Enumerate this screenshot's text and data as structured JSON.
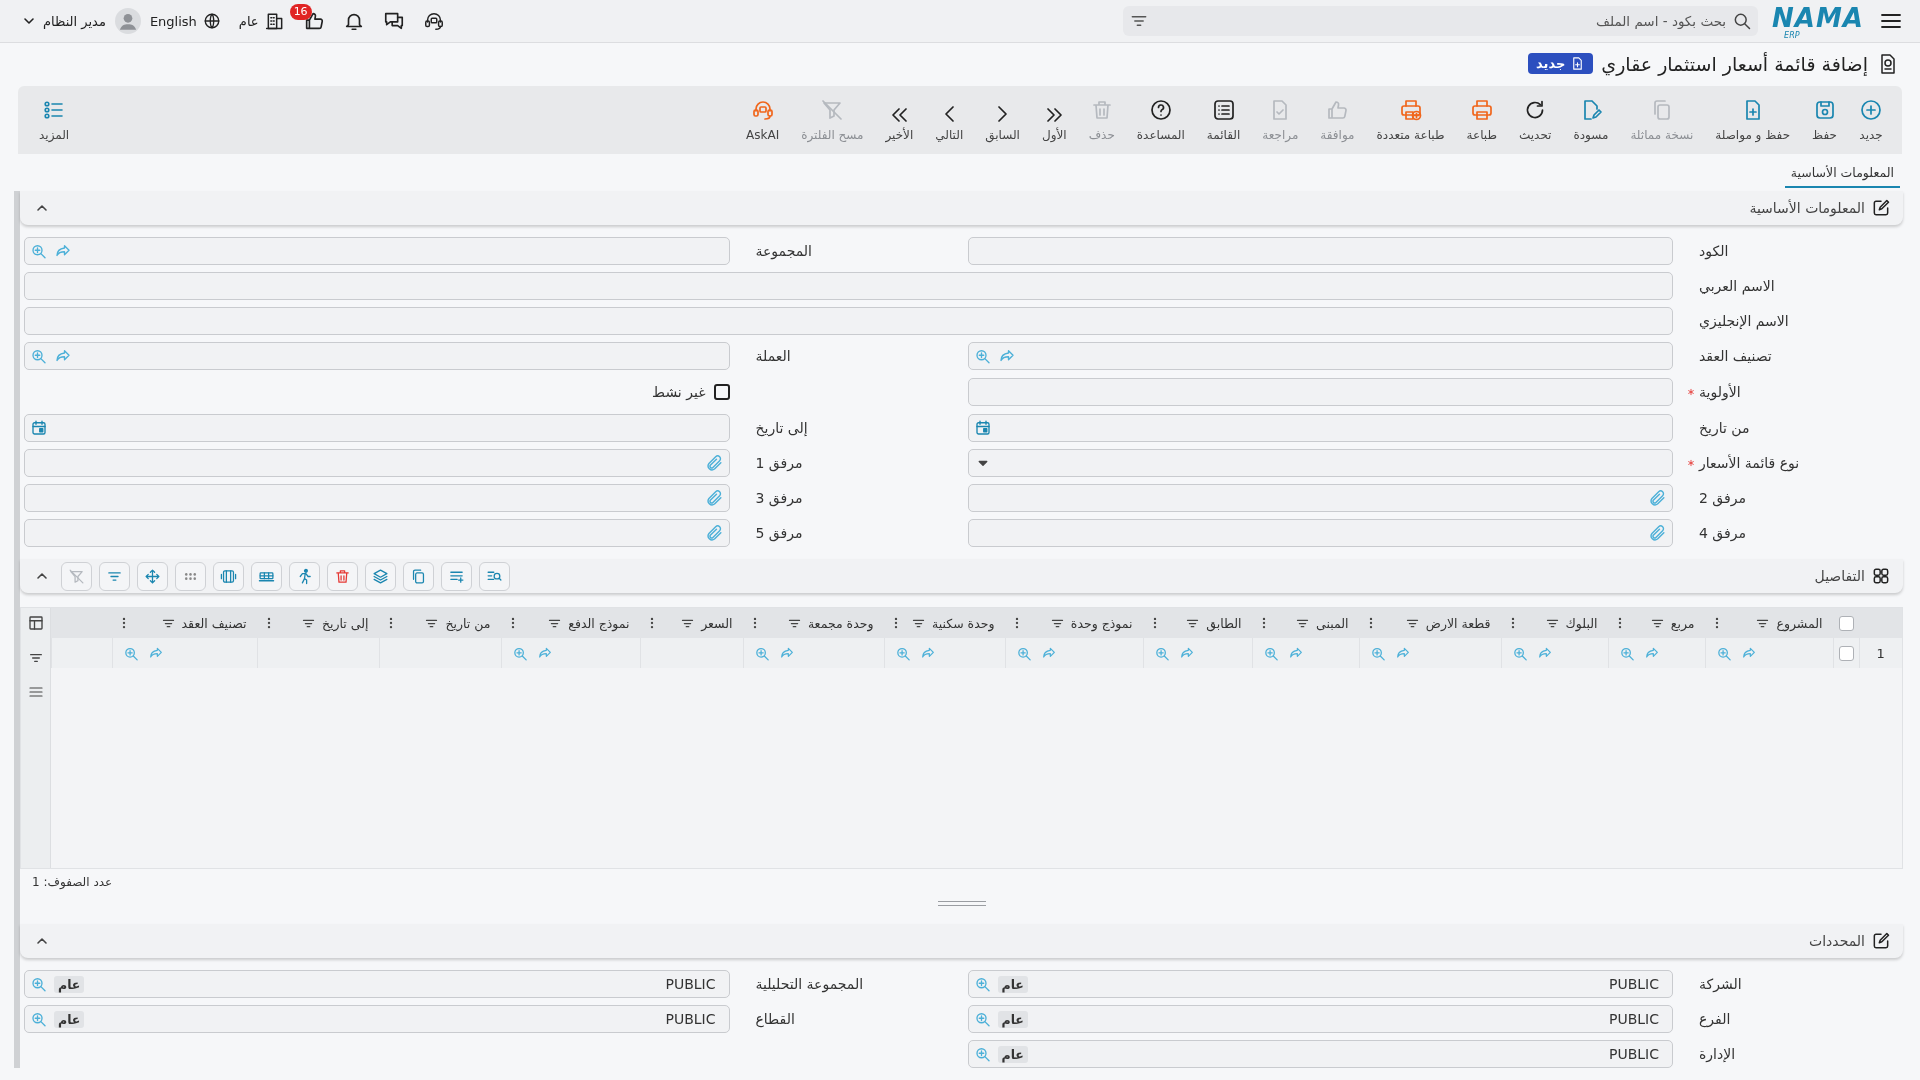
{
  "topbar": {
    "logo": "NAMA",
    "logo_sub": "ERP",
    "search": {
      "placeholder": "بحث بكود - اسم الملف"
    },
    "notification_count": "16",
    "branch": "عام",
    "language": "English",
    "user": "مدير النظام"
  },
  "page": {
    "title": "إضافة قائمة أسعار استثمار عقاري",
    "status": "جديد"
  },
  "toolbar": {
    "items": [
      {
        "kind": "add",
        "label": "جديد",
        "disabled": false
      },
      {
        "kind": "save",
        "label": "حفظ",
        "disabled": false
      },
      {
        "kind": "savenext",
        "label": "حفظ و مواصلة",
        "disabled": false
      },
      {
        "kind": "clone",
        "label": "نسخة مماثلة",
        "disabled": true
      },
      {
        "kind": "draft",
        "label": "مسودة",
        "disabled": false
      },
      {
        "kind": "refresh",
        "label": "تحديث",
        "disabled": false
      },
      {
        "kind": "print",
        "label": "طباعة",
        "disabled": false
      },
      {
        "kind": "multiprint",
        "label": "طباعة متعددة",
        "disabled": false
      },
      {
        "kind": "approve",
        "label": "موافقة",
        "disabled": true
      },
      {
        "kind": "review",
        "label": "مراجعة",
        "disabled": true
      },
      {
        "kind": "list",
        "label": "القائمة",
        "disabled": false
      },
      {
        "kind": "help",
        "label": "المساعدة",
        "disabled": false
      },
      {
        "kind": "delete",
        "label": "حذف",
        "disabled": true
      },
      {
        "kind": "first",
        "label": "الأول",
        "disabled": false
      },
      {
        "kind": "previous",
        "label": "السابق",
        "disabled": false
      },
      {
        "kind": "next",
        "label": "التالي",
        "disabled": false
      },
      {
        "kind": "last",
        "label": "الأخير",
        "disabled": false
      },
      {
        "kind": "clearfilter",
        "label": "مسح الفلترة",
        "disabled": true
      },
      {
        "kind": "askai",
        "label": "AskAI",
        "disabled": false
      }
    ],
    "more": {
      "label": "المزيد"
    }
  },
  "tabs": [
    {
      "label": "المعلومات الأساسية",
      "selected": true
    }
  ],
  "basic_info": {
    "title": "المعلومات الأساسية",
    "expanded": true,
    "fields": [
      {
        "kind": "text",
        "label": "الكود",
        "required": false
      },
      {
        "kind": "lookup",
        "label": "المجموعة",
        "required": false
      },
      {
        "kind": "fulltext",
        "label": "الاسم العربي",
        "required": false
      },
      {
        "kind": "fulltext",
        "label": "الاسم الإنجليزي",
        "required": false
      },
      {
        "kind": "lookup",
        "label": "تصنيف العقد",
        "required": false
      },
      {
        "kind": "lookup",
        "label": "العملة",
        "required": false
      },
      {
        "kind": "text",
        "label": "الأولوية",
        "required": true
      },
      {
        "kind": "checkbox",
        "label": "غير نشط",
        "checked": false
      },
      {
        "kind": "date",
        "label": "من تاريخ",
        "required": false
      },
      {
        "kind": "date",
        "label": "إلى تاريخ",
        "required": false
      },
      {
        "kind": "select",
        "label": "نوع قائمة الأسعار",
        "required": true
      },
      {
        "kind": "attachment",
        "label": "مرفق 1",
        "required": false
      },
      {
        "kind": "attachment",
        "label": "مرفق 2",
        "required": false
      },
      {
        "kind": "attachment",
        "label": "مرفق 3",
        "required": false
      },
      {
        "kind": "attachment",
        "label": "مرفق 4",
        "required": false
      },
      {
        "kind": "attachment",
        "label": "مرفق 5",
        "required": false
      }
    ]
  },
  "details": {
    "title": "التفاصيل",
    "expanded": true,
    "tools": [
      {
        "kind": "find",
        "disabled": false
      },
      {
        "kind": "addrow",
        "disabled": false
      },
      {
        "kind": "copy",
        "disabled": false
      },
      {
        "kind": "layers",
        "disabled": false
      },
      {
        "kind": "delete",
        "disabled": false
      },
      {
        "kind": "run",
        "disabled": false
      },
      {
        "kind": "rows",
        "disabled": false
      },
      {
        "kind": "columns",
        "disabled": false
      },
      {
        "kind": "dots",
        "disabled": false
      },
      {
        "kind": "move",
        "disabled": false
      },
      {
        "kind": "filter",
        "disabled": false
      },
      {
        "kind": "clearfilter",
        "disabled": true
      }
    ],
    "grid": {
      "header_checked": false,
      "columns": [
        "المشروع",
        "مربع",
        "البلوك",
        "قطعة الارض",
        "المبنى",
        "الطابق",
        "نموذج وحدة",
        "وحدة سكنية",
        "وحدة مجمعة",
        "السعر",
        "نموذج الدفع",
        "من تاريخ",
        "إلى تاريخ",
        "تصنيف العقد"
      ],
      "rows": [
        {
          "number": "1",
          "checked": false,
          "cells": [
            {
              "kind": "lookup"
            },
            {
              "kind": "lookup"
            },
            {
              "kind": "lookup"
            },
            {
              "kind": "lookup"
            },
            {
              "kind": "lookup"
            },
            {
              "kind": "lookup"
            },
            {
              "kind": "lookup"
            },
            {
              "kind": "lookup"
            },
            {
              "kind": "lookup"
            },
            {
              "kind": "plain"
            },
            {
              "kind": "lookup"
            },
            {
              "kind": "plain"
            },
            {
              "kind": "plain"
            },
            {
              "kind": "lookup"
            }
          ]
        }
      ],
      "row_count": "عدد الصفوف: 1"
    }
  },
  "limits": {
    "title": "المحددات",
    "expanded": true,
    "fields": [
      {
        "kind": "scope",
        "label": "الشركة",
        "value": "PUBLIC",
        "tag": "عام"
      },
      {
        "kind": "scope",
        "label": "المجموعة التحليلية",
        "value": "PUBLIC",
        "tag": "عام"
      },
      {
        "kind": "scope",
        "label": "الفرع",
        "value": "PUBLIC",
        "tag": "عام"
      },
      {
        "kind": "scope",
        "label": "القطاع",
        "value": "PUBLIC",
        "tag": "عام"
      },
      {
        "kind": "scope",
        "label": "الإدارة",
        "value": "PUBLIC",
        "tag": "عام"
      }
    ]
  }
}
